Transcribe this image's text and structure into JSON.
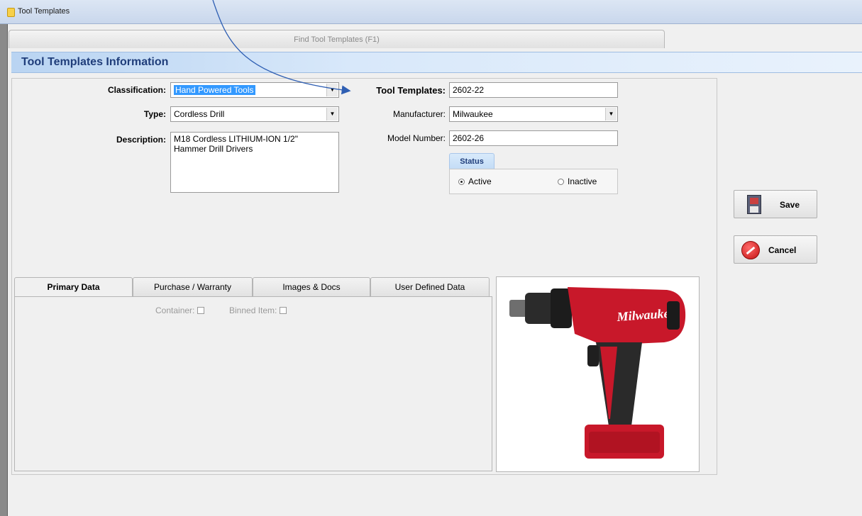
{
  "window": {
    "title": "Tool Templates"
  },
  "find_tab": {
    "label": "Find Tool Templates (F1)"
  },
  "section": {
    "title": "Tool Templates Information"
  },
  "form": {
    "classification": {
      "label": "Classification:",
      "value": "Hand Powered Tools"
    },
    "type": {
      "label": "Type:",
      "value": "Cordless Drill"
    },
    "description": {
      "label": "Description:",
      "value": "M18 Cordless LITHIUM-ION 1/2\"\nHammer Drill Drivers"
    },
    "tool_templates": {
      "label": "Tool Templates:",
      "value": "2602-22"
    },
    "manufacturer": {
      "label": "Manufacturer:",
      "value": "Milwaukee"
    },
    "model_number": {
      "label": "Model Number:",
      "value": "2602-26"
    },
    "status": {
      "label": "Status",
      "active": "Active",
      "inactive": "Inactive",
      "selected": "Active"
    }
  },
  "buttons": {
    "save": "Save",
    "cancel": "Cancel"
  },
  "tabs": [
    {
      "label": "Primary Data",
      "active": true
    },
    {
      "label": "Purchase / Warranty",
      "active": false
    },
    {
      "label": "Images & Docs",
      "active": false
    },
    {
      "label": "User Defined Data",
      "active": false
    }
  ],
  "primary_data": {
    "container_label": "Container:",
    "binned_item_label": "Binned Item:"
  },
  "image": {
    "brand_mark": "Milwaukee"
  },
  "icons": [
    "app-icon",
    "dropdown-arrow-icon",
    "save-icon",
    "cancel-icon",
    "annotation-arrow"
  ],
  "colors": {
    "header_text": "#1f3d7a",
    "selection": "#3399ff",
    "arrow": "#2f5fb3",
    "drill_red": "#c8182a"
  }
}
